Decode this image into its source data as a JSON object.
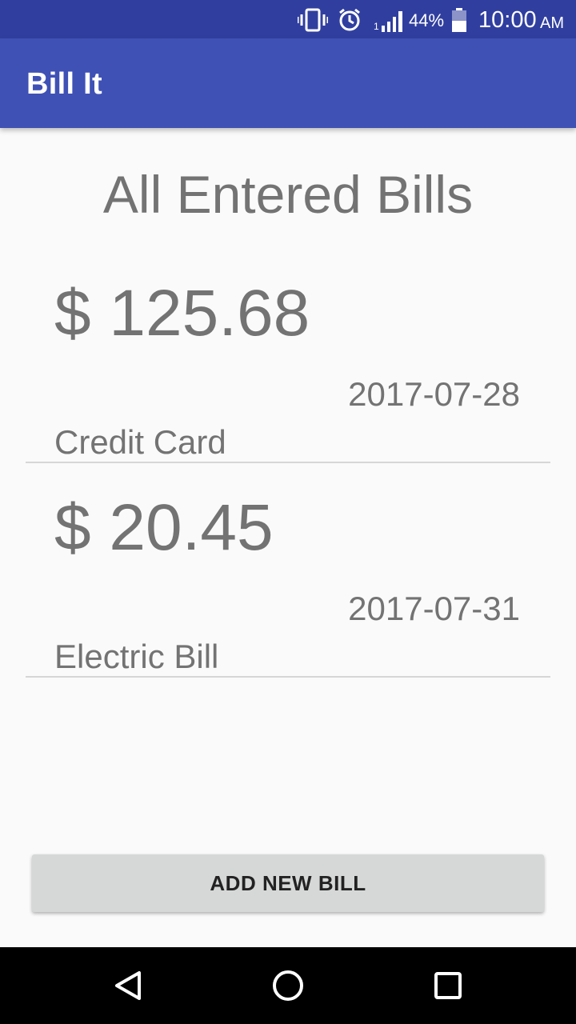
{
  "status_bar": {
    "icons": [
      "vibrate-icon",
      "alarm-icon",
      "signal-icon",
      "battery-icon"
    ],
    "sim_slot": "1",
    "battery_percent": "44%",
    "time": "10:00",
    "time_suffix": "AM"
  },
  "app_bar": {
    "title": "Bill It",
    "color": "#3f51b5",
    "status_color": "#303f9f"
  },
  "main": {
    "heading": "All Entered Bills",
    "bills": [
      {
        "amount": "$ 125.68",
        "date": "2017-07-28",
        "name": "Credit Card"
      },
      {
        "amount": "$ 20.45",
        "date": "2017-07-31",
        "name": "Electric Bill"
      }
    ],
    "add_button_label": "ADD NEW BILL"
  },
  "nav_bar": {
    "icons": [
      "back-icon",
      "home-icon",
      "recents-icon"
    ]
  }
}
